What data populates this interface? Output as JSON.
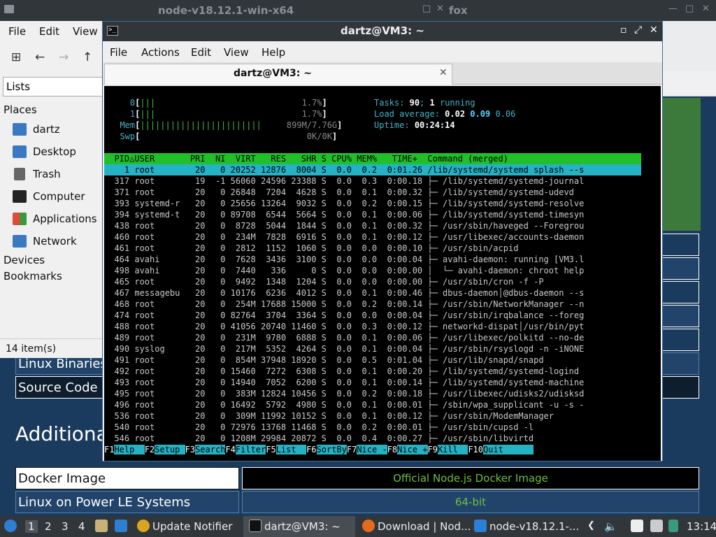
{
  "background_window": {
    "title": "node-v18.12.1-win-x64",
    "title_suffix": "fox",
    "rows": [
      {
        "label": "Linux Binaries",
        "button": ""
      },
      {
        "label": "Source Code",
        "button": ""
      },
      {
        "label": "Docker Image",
        "button": "Official Node.js Docker Image"
      },
      {
        "label": "Linux on Power LE Systems",
        "button": "64-bit"
      }
    ],
    "section_heading": "Additiona"
  },
  "file_manager": {
    "menu": [
      "File",
      "Edit",
      "View"
    ],
    "path": "Lists",
    "places_heading": "Places",
    "places": [
      {
        "label": "dartz",
        "icon": "home-folder-icon",
        "color": "#3a78c4"
      },
      {
        "label": "Desktop",
        "icon": "desktop-folder-icon",
        "color": "#3a78c4"
      },
      {
        "label": "Trash",
        "icon": "trash-icon",
        "color": "#555555"
      },
      {
        "label": "Computer",
        "icon": "computer-icon",
        "color": "#222222"
      },
      {
        "label": "Applications",
        "icon": "applications-icon",
        "color": "#e04a3a"
      },
      {
        "label": "Network",
        "icon": "network-icon",
        "color": "#3a78c4"
      }
    ],
    "devices_heading": "Devices",
    "bookmarks_heading": "Bookmarks",
    "status": "14 item(s)"
  },
  "terminal": {
    "title": "dartz@VM3: ~",
    "menu": [
      "File",
      "Actions",
      "Edit",
      "View",
      "Help"
    ],
    "tab_label": "dartz@VM3: ~",
    "htop": {
      "cpu0": {
        "label": "0",
        "bars": "|||",
        "percent": "1.7%"
      },
      "cpu1": {
        "label": "1",
        "bars": "|||",
        "percent": "1.7%"
      },
      "mem": {
        "label": "Mem",
        "bars": "||||||||||||||||||||||||",
        "value": "899M/7.76G"
      },
      "swp": {
        "label": "Swp",
        "bars": "",
        "value": "0K/0K"
      },
      "tasks_label": "Tasks:",
      "tasks_count": "90",
      "tasks_sep": ";",
      "tasks_running": "1",
      "tasks_running_label": "running",
      "load_label": "Load average:",
      "load1": "0.02",
      "load5": "0.09",
      "load15": "0.06",
      "uptime_label": "Uptime:",
      "uptime": "00:24:14",
      "header": "  PID△USER       PRI  NI  VIRT   RES   SHR S CPU% MEM%   TIME+  Command (merged)",
      "processes": [
        "    1 root        20   0 20252 12876  8004 S  0.0  0.2  0:01.26 /lib/systemd/systemd splash --s",
        "  317 root        19  -1 56060 24596 23388 S  0.0  0.3  0:00.18 ├─ /lib/systemd/systemd-journal",
        "  371 root        20   0 26848  7204  4628 S  0.0  0.1  0:00.32 ├─ /lib/systemd/systemd-udevd",
        "  393 systemd-r   20   0 25656 13264  9032 S  0.0  0.2  0:00.15 ├─ /lib/systemd/systemd-resolve",
        "  394 systemd-t   20   0 89708  6544  5664 S  0.0  0.1  0:00.06 ├─ /lib/systemd/systemd-timesyn",
        "  438 root        20   0  8728  5044  1844 S  0.0  0.1  0:00.32 ├─ /usr/sbin/haveged --Foregrou",
        "  460 root        20   0  234M  7828  6916 S  0.0  0.1  0:00.12 ├─ /usr/libexec/accounts-daemon",
        "  461 root        20   0  2812  1152  1060 S  0.0  0.0  0:00.10 ├─ /usr/sbin/acpid",
        "  464 avahi       20   0  7628  3436  3100 S  0.0  0.0  0:00.04 ├─ avahi-daemon: running [VM3.l",
        "  498 avahi       20   0  7440   336     0 S  0.0  0.0  0:00.00 │  └─ avahi-daemon: chroot help",
        "  465 root        20   0  9492  1348  1204 S  0.0  0.0  0:00.00 ├─ /usr/sbin/cron -f -P",
        "  467 messagebu   20   0 10176  6236  4012 S  0.0  0.1  0:00.46 ├─ dbus-daemon│@dbus-daemon --s",
        "  468 root        20   0  254M 17688 15000 S  0.0  0.2  0:00.14 ├─ /usr/sbin/NetworkManager --n",
        "  474 root        20   0 82764  3704  3364 S  0.0  0.0  0:00.04 ├─ /usr/sbin/irqbalance --foreg",
        "  488 root        20   0 41056 20740 11460 S  0.0  0.3  0:00.12 ├─ networkd-dispat│/usr/bin/pyt",
        "  489 root        20   0  231M  9780  6888 S  0.0  0.1  0:00.06 ├─ /usr/libexec/polkitd --no-de",
        "  490 syslog      20   0  217M  5352  4264 S  0.0  0.1  0:00.04 ├─ /usr/sbin/rsyslogd -n -iNONE",
        "  491 root        20   0  854M 37948 18920 S  0.0  0.5  0:01.04 ├─ /usr/lib/snapd/snapd",
        "  492 root        20   0 15460  7272  6308 S  0.0  0.1  0:00.20 ├─ /lib/systemd/systemd-logind",
        "  493 root        20   0 14940  7052  6200 S  0.0  0.1  0:00.14 ├─ /lib/systemd/systemd-machine",
        "  495 root        20   0  383M 12824 10456 S  0.0  0.2  0:00.18 ├─ /usr/libexec/udisks2/udisksd",
        "  496 root        20   0 16492  5792  4980 S  0.0  0.1  0:00.01 ├─ /sbin/wpa_supplicant -u -s -",
        "  536 root        20   0  309M 11992 10152 S  0.0  0.1  0:00.12 ├─ /usr/sbin/ModemManager",
        "  540 root        20   0 72976 13768 11468 S  0.0  0.2  0:00.01 ├─ /usr/sbin/cupsd -l",
        "  546 root        20   0 1208M 29984 20872 S  0.0  0.4  0:00.27 ├─ /usr/sbin/libvirtd"
      ],
      "fkeys": [
        {
          "key": "F1",
          "label": "Help  "
        },
        {
          "key": "F2",
          "label": "Setup "
        },
        {
          "key": "F3",
          "label": "Search"
        },
        {
          "key": "F4",
          "label": "Filter"
        },
        {
          "key": "F5",
          "label": "List  "
        },
        {
          "key": "F6",
          "label": "SortBy"
        },
        {
          "key": "F7",
          "label": "Nice -"
        },
        {
          "key": "F8",
          "label": "Nice +"
        },
        {
          "key": "F9",
          "label": "Kill  "
        },
        {
          "key": "F10",
          "label": "Quit      "
        }
      ]
    }
  },
  "taskbar": {
    "workspaces": [
      "1",
      "2",
      "3",
      "4"
    ],
    "update_notifier": "Update Notifier",
    "terminal_task": "dartz@VM3: ~",
    "firefox_task": "Download | Nod...",
    "folder_task": "node-v18.12.1-...",
    "clock": "13:14"
  }
}
